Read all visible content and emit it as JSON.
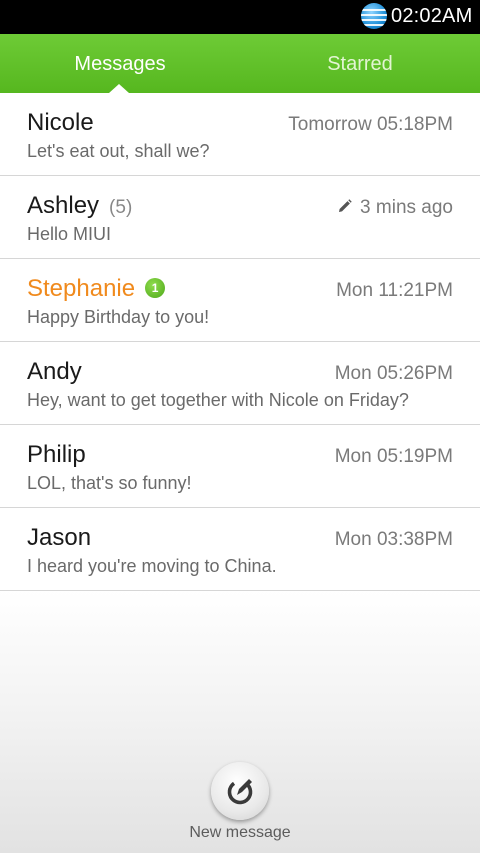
{
  "status_bar": {
    "carrier_icon": "att-globe-icon",
    "time": "02:02AM"
  },
  "tabs": [
    {
      "label": "Messages",
      "selected": true
    },
    {
      "label": "Starred",
      "selected": false
    }
  ],
  "threads": [
    {
      "name": "Nicole",
      "time": "Tomorrow 05:18PM",
      "snippet": "Let's eat out, shall we?"
    },
    {
      "name": "Ashley",
      "count": "(5)",
      "draft": true,
      "time": "3 mins ago",
      "snippet": "Hello MIUI"
    },
    {
      "name": "Stephanie",
      "unread": true,
      "badge": "1",
      "time": "Mon 11:21PM",
      "snippet": "Happy Birthday to you!"
    },
    {
      "name": "Andy",
      "time": "Mon 05:26PM",
      "snippet": "Hey, want to get together with Nicole on Friday?"
    },
    {
      "name": "Philip",
      "time": "Mon 05:19PM",
      "snippet": "LOL, that's so funny!"
    },
    {
      "name": "Jason",
      "time": "Mon 03:38PM",
      "snippet": "I heard you're moving to China."
    }
  ],
  "compose": {
    "label": "New message",
    "icon": "compose-icon"
  },
  "colors": {
    "tab_bar": "#5fbf27",
    "unread_name": "#f08a1d",
    "badge": "#5cb521"
  }
}
